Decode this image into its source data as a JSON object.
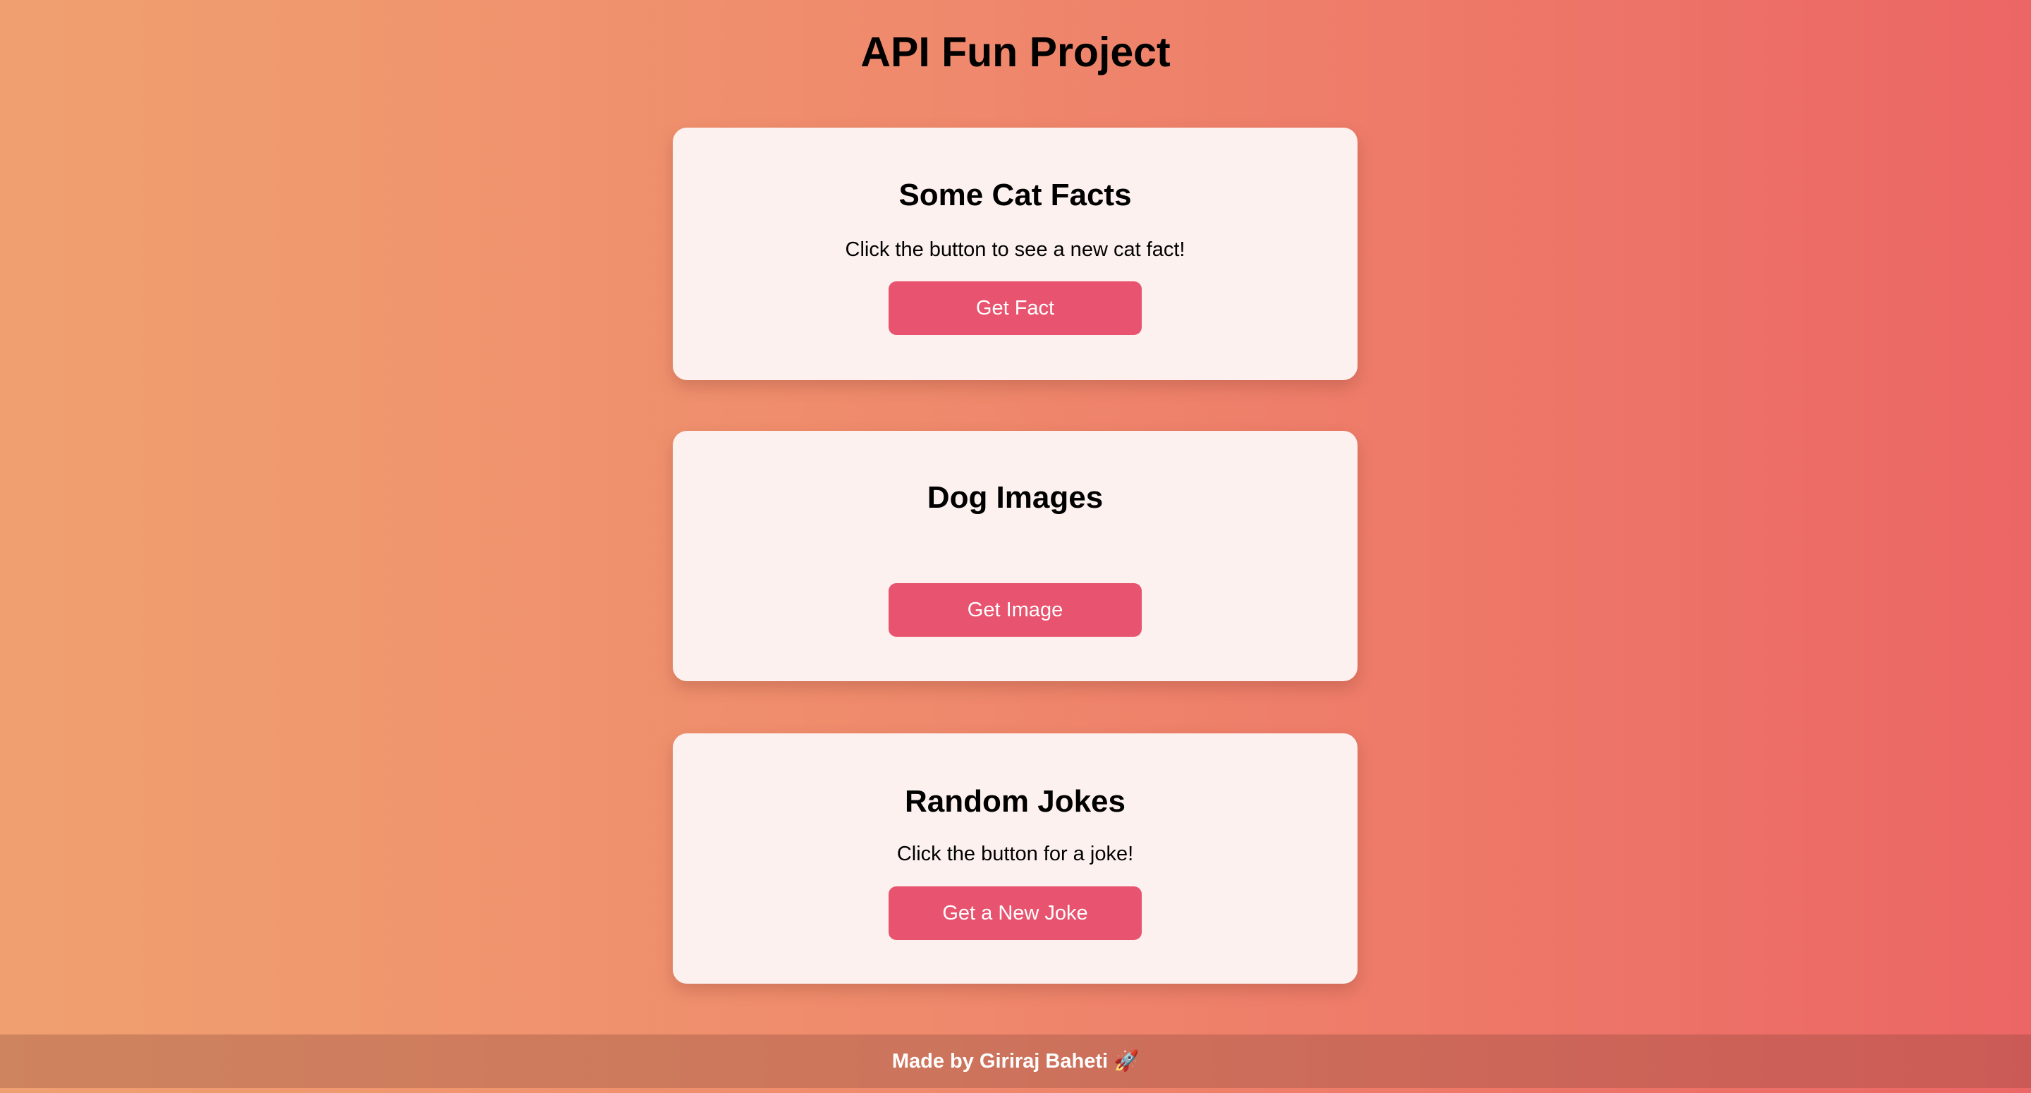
{
  "header": {
    "title": "API Fun Project"
  },
  "cards": [
    {
      "title": "Some Cat Facts",
      "text": "Click the button to see a new cat fact!",
      "button_label": "Get Fact"
    },
    {
      "title": "Dog Images",
      "text": "",
      "button_label": "Get Image"
    },
    {
      "title": "Random Jokes",
      "text": "Click the button for a joke!",
      "button_label": "Get a New Joke"
    }
  ],
  "footer": {
    "text": "Made by Giriraj Baheti",
    "icon": "rocket-icon"
  },
  "colors": {
    "background_gradient_start": "#f0a070",
    "background_gradient_end": "#ec6665",
    "card_background": "#fcf1ee",
    "button_background": "#e8536f",
    "button_text": "#ffffff"
  }
}
